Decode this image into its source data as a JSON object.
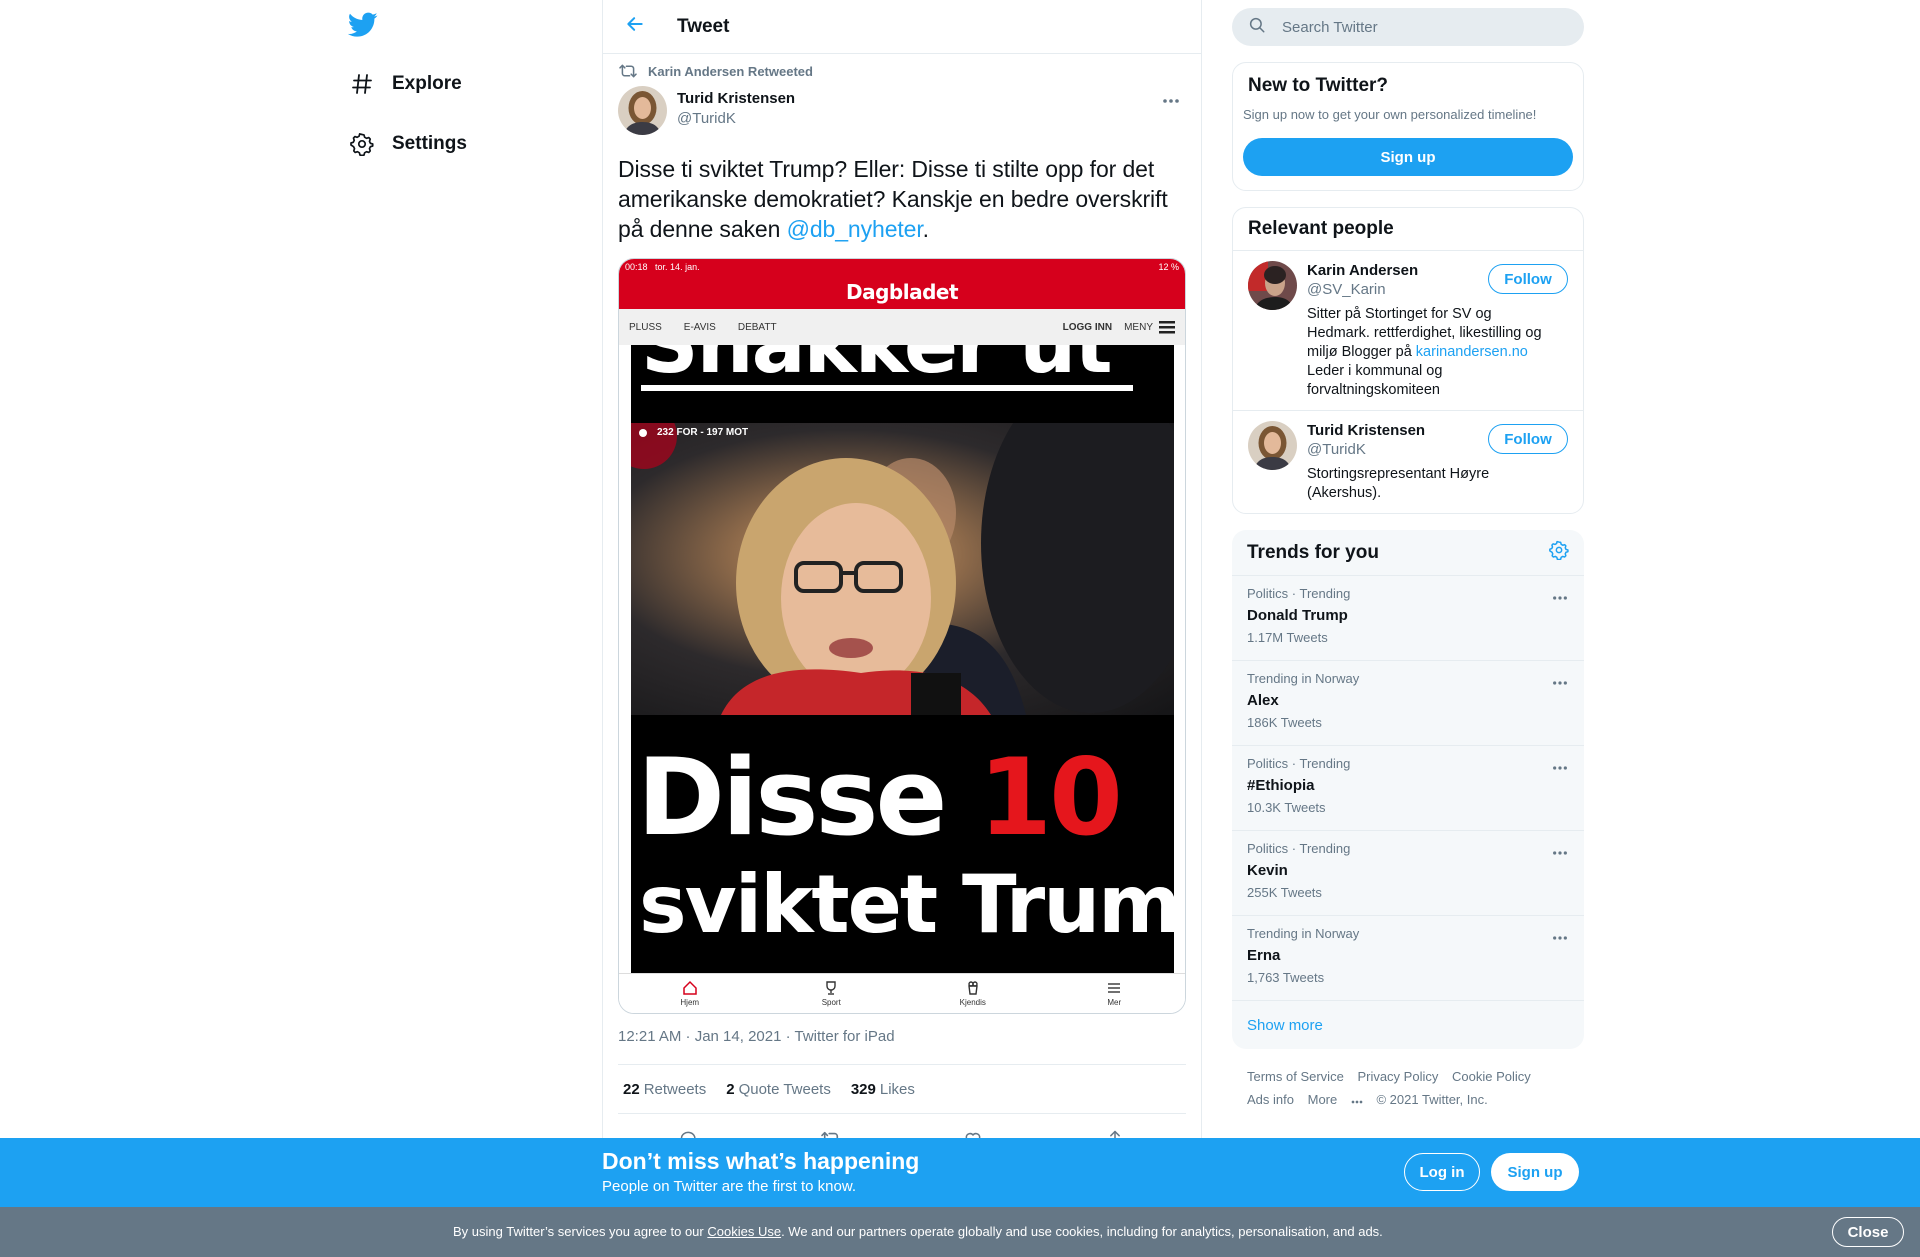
{
  "nav": {
    "explore_label": "Explore",
    "settings_label": "Settings"
  },
  "header": {
    "title": "Tweet"
  },
  "tweet": {
    "retweeted_by": "Karin Andersen Retweeted",
    "author_name": "Turid Kristensen",
    "author_handle": "@TuridK",
    "text_before": "Disse ti sviktet Trump? Eller: Disse ti stilte opp for det amerikanske demokratiet? Kanskje en bedre overskrift på denne saken ",
    "mention": "@db_nyheter",
    "text_after": ".",
    "media": {
      "status_time": "00:18",
      "status_date": "tor. 14. jan.",
      "status_right": "12 %",
      "brand": "Dagbladet",
      "menu": [
        "PLUSS",
        "E-AVIS",
        "DEBATT"
      ],
      "login": "LOGG INN",
      "menu_right": "MENY",
      "headline_top": "Snakker ut",
      "vote_badge": "232 FOR - 197 MOT",
      "headline_a": "Disse ",
      "headline_num": "10",
      "headline_b": "sviktet Trump",
      "tabs": [
        "Hjem",
        "Sport",
        "Kjendis",
        "Mer"
      ]
    },
    "timestamp": "12:21 AM · Jan 14, 2021",
    "source": "Twitter for iPad",
    "retweets": "22",
    "retweets_label": "Retweets",
    "quotes": "2",
    "quotes_label": "Quote Tweets",
    "likes": "329",
    "likes_label": "Likes"
  },
  "search": {
    "placeholder": "Search Twitter"
  },
  "new_to_twitter": {
    "title": "New to Twitter?",
    "subtitle": "Sign up now to get your own personalized timeline!",
    "signup_label": "Sign up"
  },
  "relevant_people": {
    "title": "Relevant people",
    "follow_label": "Follow",
    "people": [
      {
        "name": "Karin Andersen",
        "handle": "@SV_Karin",
        "bio_before": "Sitter på Stortinget for SV og Hedmark. rettferdighet, likestilling og miljø Blogger på ",
        "bio_link": "karinandersen.no",
        "bio_after": " Leder i kommunal og forvaltningskomiteen"
      },
      {
        "name": "Turid Kristensen",
        "handle": "@TuridK",
        "bio_before": "Stortingsrepresentant Høyre (Akershus).",
        "bio_link": "",
        "bio_after": ""
      }
    ]
  },
  "trends": {
    "title": "Trends for you",
    "items": [
      {
        "context": "Politics · Trending",
        "name": "Donald Trump",
        "count": "1.17M Tweets"
      },
      {
        "context": "Trending in Norway",
        "name": "Alex",
        "count": "186K Tweets"
      },
      {
        "context": "Politics · Trending",
        "name": "#Ethiopia",
        "count": "10.3K Tweets"
      },
      {
        "context": "Politics · Trending",
        "name": "Kevin",
        "count": "255K Tweets"
      },
      {
        "context": "Trending in Norway",
        "name": "Erna",
        "count": "1,763 Tweets"
      }
    ],
    "show_more": "Show more"
  },
  "footer": {
    "terms": "Terms of Service",
    "privacy": "Privacy Policy",
    "cookie": "Cookie Policy",
    "ads": "Ads info",
    "more": "More",
    "copyright": "© 2021 Twitter, Inc."
  },
  "promo": {
    "title": "Don’t miss what’s happening",
    "subtitle": "People on Twitter are the first to know.",
    "login_label": "Log in",
    "signup_label": "Sign up"
  },
  "cookie_bar": {
    "text_before": "By using Twitter’s services you agree to our ",
    "link": "Cookies Use",
    "text_after": ". We and our partners operate globally and use cookies, including for analytics, personalisation, and ads.",
    "close_label": "Close"
  },
  "colors": {
    "brand_blue": "#1da1f2",
    "secondary_text": "#657786",
    "dagbladet_red": "#d6001c"
  },
  "icons": [
    "twitter-logo-icon",
    "hashtag-icon",
    "gear-icon",
    "back-arrow-icon",
    "retweet-icon",
    "more-icon",
    "search-icon",
    "reply-icon",
    "like-icon",
    "share-icon"
  ]
}
